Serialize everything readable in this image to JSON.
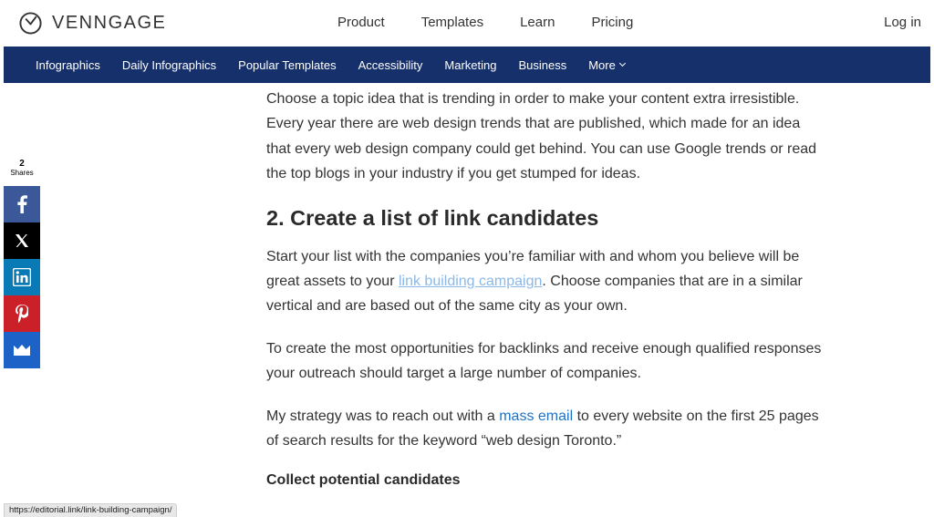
{
  "header": {
    "brand": "VENNGAGE",
    "nav": [
      "Product",
      "Templates",
      "Learn",
      "Pricing"
    ],
    "login": "Log in"
  },
  "category_bar": {
    "items": [
      "Infographics",
      "Daily Infographics",
      "Popular Templates",
      "Accessibility",
      "Marketing",
      "Business"
    ],
    "more": "More"
  },
  "share": {
    "count": "2",
    "label": "Shares",
    "buttons": [
      "facebook-icon",
      "x-icon",
      "linkedin-icon",
      "pinterest-icon",
      "sumo-crown-icon"
    ],
    "colors": {
      "facebook": "#3b5998",
      "x": "#000000",
      "linkedin": "#0a7ab6",
      "pinterest": "#cb2027",
      "crown": "#1d63c7"
    }
  },
  "article": {
    "intro": "Choose a topic idea that is trending in order to make your content extra irresistible. Every year there are web design trends that are published, which made for an idea that every web design company could get behind. You can use Google trends or read the top blogs in your industry if you get stumped for ideas.",
    "heading": "2. Create a list of link candidates",
    "p1_before": "Start your list with the companies you’re familiar with and whom you believe will be great assets to your ",
    "p1_link": "link building campaign",
    "p1_after": ". Choose companies that are in a similar vertical and are based out of the same city as your own.",
    "p2": "To create the most opportunities for backlinks and receive enough qualified responses your outreach should target a large number of companies.",
    "p3_before": "My strategy was to reach out with a ",
    "p3_link": "mass email",
    "p3_after": " to every website on the first 25 pages of search results for the keyword “web design Toronto.”",
    "subheading": "Collect potential candidates"
  },
  "status_bar": {
    "url": "https://editorial.link/link-building-campaign/"
  },
  "colors": {
    "nav_bar": "#16306b",
    "link_visited": "#8ab8e8",
    "link": "#1a73c9"
  }
}
